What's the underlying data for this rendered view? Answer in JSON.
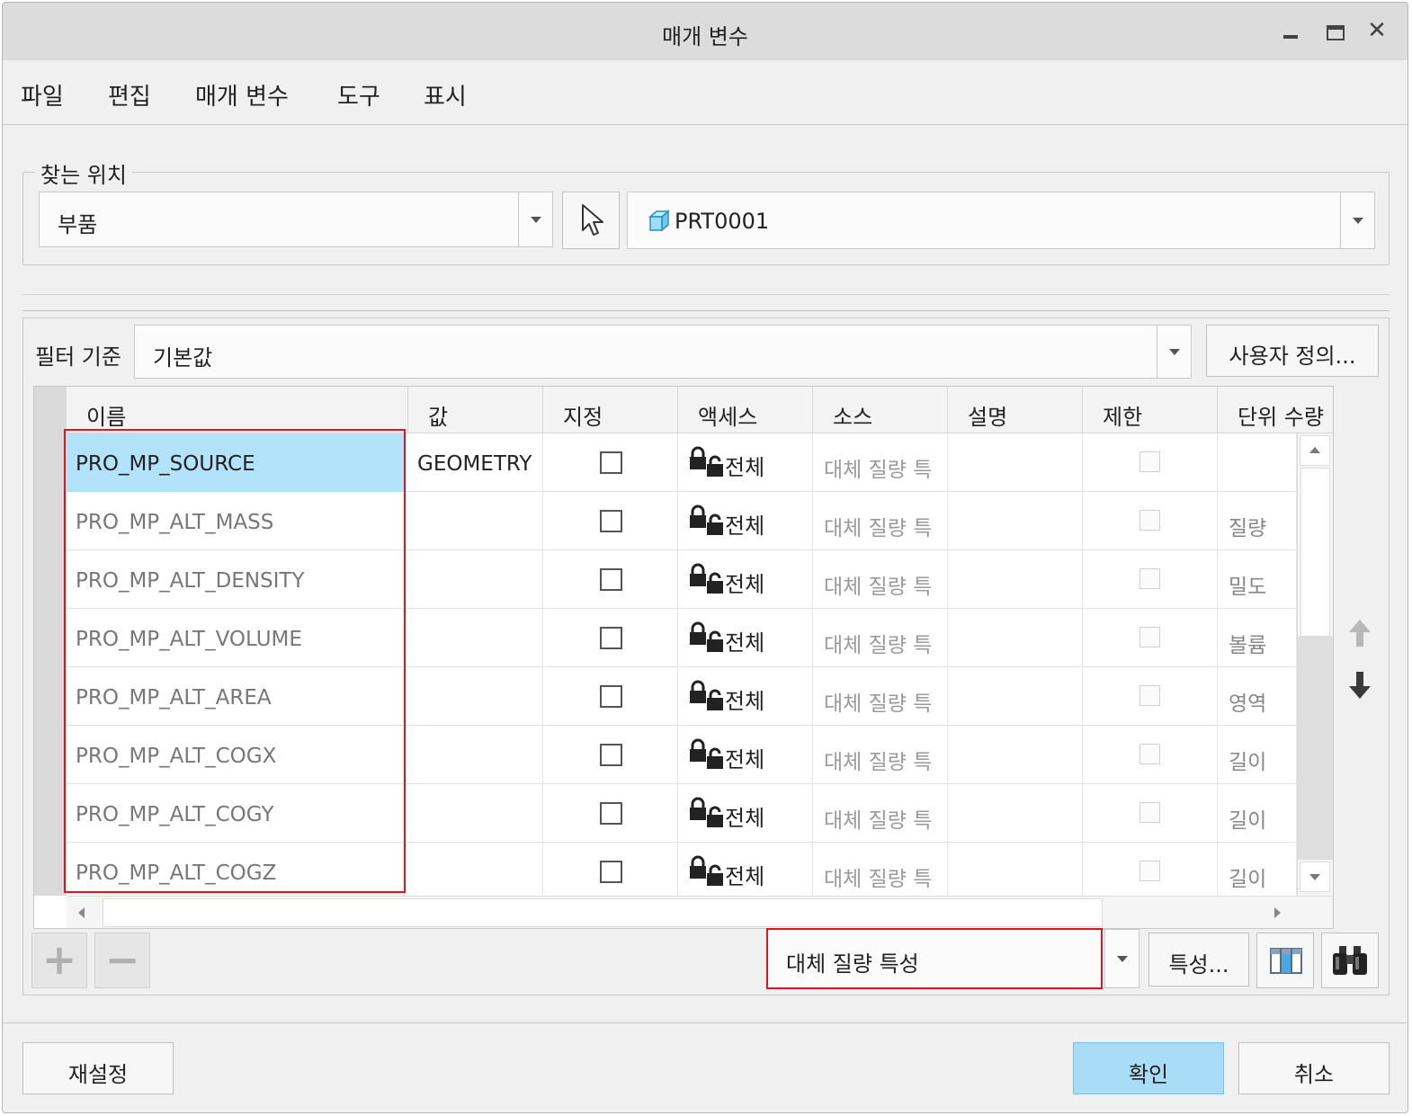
{
  "window": {
    "title": "매개 변수",
    "controls": [
      "minimize",
      "maximize",
      "close"
    ],
    "close_glyph": "✕"
  },
  "menu": {
    "items": [
      "파일",
      "편집",
      "매개 변수",
      "도구",
      "표시"
    ]
  },
  "lookup": {
    "group_label": "찾는 위치",
    "scope_value": "부품",
    "object_value": "PRT0001",
    "select_icon": "cursor-arrow-icon",
    "object_icon": "part-cube-icon"
  },
  "filter": {
    "label": "필터 기준",
    "value": "기본값",
    "customize_label": "사용자 정의..."
  },
  "table": {
    "columns": [
      "이름",
      "값",
      "지정",
      "액세스",
      "소스",
      "설명",
      "제한",
      "단위 수량"
    ],
    "rows": [
      {
        "name": "PRO_MP_SOURCE",
        "value": "GEOMETRY",
        "designate": false,
        "access": "전체",
        "source": "대체 질량 특",
        "description": "",
        "restricted": false,
        "unit": "",
        "selected": true
      },
      {
        "name": "PRO_MP_ALT_MASS",
        "value": "",
        "designate": false,
        "access": "전체",
        "source": "대체 질량 특",
        "description": "",
        "restricted": false,
        "unit": "질량",
        "selected": false
      },
      {
        "name": "PRO_MP_ALT_DENSITY",
        "value": "",
        "designate": false,
        "access": "전체",
        "source": "대체 질량 특",
        "description": "",
        "restricted": false,
        "unit": "밀도",
        "selected": false
      },
      {
        "name": "PRO_MP_ALT_VOLUME",
        "value": "",
        "designate": false,
        "access": "전체",
        "source": "대체 질량 특",
        "description": "",
        "restricted": false,
        "unit": "볼륨",
        "selected": false
      },
      {
        "name": "PRO_MP_ALT_AREA",
        "value": "",
        "designate": false,
        "access": "전체",
        "source": "대체 질량 특",
        "description": "",
        "restricted": false,
        "unit": "영역",
        "selected": false
      },
      {
        "name": "PRO_MP_ALT_COGX",
        "value": "",
        "designate": false,
        "access": "전체",
        "source": "대체 질량 특",
        "description": "",
        "restricted": false,
        "unit": "길이",
        "selected": false
      },
      {
        "name": "PRO_MP_ALT_COGY",
        "value": "",
        "designate": false,
        "access": "전체",
        "source": "대체 질량 특",
        "description": "",
        "restricted": false,
        "unit": "길이",
        "selected": false
      },
      {
        "name": "PRO_MP_ALT_COGZ",
        "value": "",
        "designate": false,
        "access": "전체",
        "source": "대체 질량 특",
        "description": "",
        "restricted": false,
        "unit": "길이",
        "selected": false
      }
    ]
  },
  "bottom_toolbar": {
    "add_glyph": "+",
    "remove_glyph": "−",
    "property_filter_value": "대체 질량 특성",
    "properties_label": "특성...",
    "table_icon": "table-columns-icon",
    "find_icon": "binoculars-icon"
  },
  "footer": {
    "reset_label": "재설정",
    "ok_label": "확인",
    "cancel_label": "취소"
  },
  "colors": {
    "selection": "#b3e3fb",
    "primary_button": "#a9ddf7",
    "highlight": "#e0141e"
  }
}
